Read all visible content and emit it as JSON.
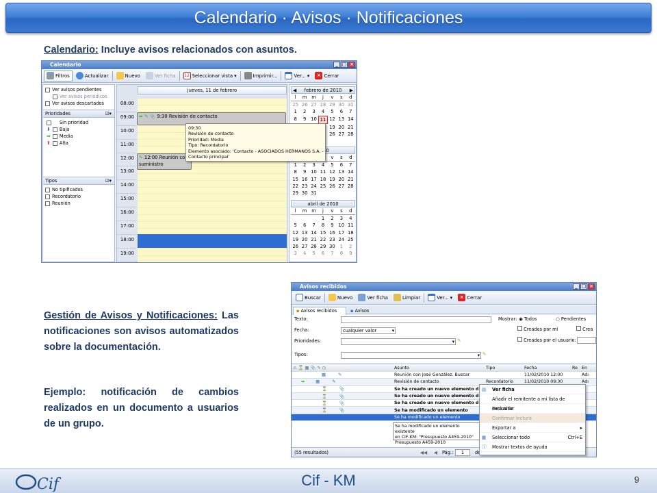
{
  "slide": {
    "title": "Calendario · Avisos · Notificaciones",
    "footer": "Cif - KM",
    "page": "9",
    "logo": "Cif"
  },
  "text1": {
    "label": "Calendario:",
    "body": " Incluye avisos relacionados con asuntos."
  },
  "text2": {
    "label": "Gestión de Avisos y Notificaciones:",
    "body": " Las notificaciones son avisos automatizados sobre la documentación.",
    "example": "Ejemplo: notificación de cambios realizados en un documento a usuarios de un grupo."
  },
  "cal": {
    "title": "Calendario",
    "toolbar": [
      "Filtros",
      "Actualizar",
      "Nuevo",
      "Ver ficha",
      "Seleccionar vista",
      "Imprimir...",
      "Ver...",
      "Cerrar"
    ],
    "filters": [
      "Ver avisos pendientes",
      "Ver avisos periódicos",
      "Ver avisos descartados"
    ],
    "prioridades": {
      "label": "Prioridades",
      "items": [
        "Sin prioridad",
        "Baja",
        "Media",
        "Alta"
      ]
    },
    "tipos": {
      "label": "Tipos",
      "items": [
        "No tipificados",
        "Recordatorio",
        "Reunión"
      ]
    },
    "day": "jueves, 11 de febrero",
    "hours": [
      "08:00",
      "09:00",
      "10:00",
      "11:00",
      "12:00",
      "13:00",
      "14:00",
      "15:00",
      "16:00",
      "17:00",
      "18:00",
      "19:00"
    ],
    "event1": "9:30 Revisión de contacto",
    "event2": "12:00 Reunión co",
    "event2b": "suministro",
    "tooltip": [
      "09:30",
      "Revisión de contacto",
      "Prioridad: Media",
      "Tipo: Recordatorio",
      "Elemento asociado: 'Contacto - ASOCIADOS HERMANOS S.A. -",
      "Contacto principal'"
    ],
    "weekdays": [
      "l",
      "m",
      "m",
      "j",
      "v",
      "s",
      "d"
    ],
    "months": [
      {
        "name": "febrero de 2010",
        "rows": [
          [
            "25",
            "26",
            "27",
            "28",
            "29",
            "30",
            "31"
          ],
          [
            "1",
            "2",
            "3",
            "4",
            "5",
            "6",
            "7"
          ],
          [
            "8",
            "9",
            "10",
            "11",
            "12",
            "13",
            "14"
          ],
          [
            "15",
            "16",
            "17",
            "18",
            "19",
            "20",
            "21"
          ],
          [
            "22",
            "23",
            "24",
            "25",
            "26",
            "27",
            "28"
          ]
        ]
      },
      {
        "name": "2010",
        "rows": [
          [
            "1",
            "2",
            "3",
            "4",
            "5",
            "6",
            "7"
          ],
          [
            "8",
            "9",
            "10",
            "11",
            "12",
            "13",
            "14"
          ],
          [
            "15",
            "16",
            "17",
            "18",
            "19",
            "20",
            "21"
          ],
          [
            "22",
            "23",
            "24",
            "25",
            "26",
            "27",
            "28"
          ],
          [
            "29",
            "30",
            "31",
            "",
            "",
            "",
            ""
          ]
        ]
      },
      {
        "name": "abril de 2010",
        "rows": [
          [
            "",
            "",
            "",
            "1",
            "2",
            "3",
            "4"
          ],
          [
            "5",
            "6",
            "7",
            "8",
            "9",
            "10",
            "11"
          ],
          [
            "12",
            "13",
            "14",
            "15",
            "16",
            "17",
            "18"
          ],
          [
            "19",
            "20",
            "21",
            "22",
            "23",
            "24",
            "25"
          ],
          [
            "26",
            "27",
            "28",
            "29",
            "30",
            "1",
            "2"
          ],
          [
            "3",
            "4",
            "5",
            "6",
            "7",
            "8",
            "9"
          ]
        ]
      }
    ]
  },
  "av": {
    "title": "Avisos recibidos",
    "toolbar": [
      "Buscar",
      "Nuevo",
      "Ver ficha",
      "Limpiar",
      "Ver...",
      "Cerrar"
    ],
    "tabs": [
      "Avisos recibidos",
      "Avisos enviados"
    ],
    "form": {
      "texto": "Texto:",
      "fecha": "Fecha:",
      "fecha_val": "cualquier valor",
      "prioridades": "Prioridades:",
      "tipos": "Tipos:",
      "mostrar": "Mostrar:",
      "todos": "Todos",
      "pendientes": "Pendientes",
      "creadas_mi": "Creadas por mí",
      "crea": "Crea",
      "creadas_usuario": "Creadas por el usuario:"
    },
    "cols": [
      "Asunto",
      "Tipo",
      "Fecha",
      "Re",
      "En"
    ],
    "rows": [
      {
        "asunto": "Reunión con José González. Buscar",
        "tipo": "",
        "fecha": "11/02/2010 12:00",
        "en": "Adı"
      },
      {
        "asunto": "Revisión de contacto",
        "tipo": "Recordatorio",
        "fecha": "11/02/2010 09:30",
        "en": "Adı"
      },
      {
        "asunto": "Se ha creado un nuevo elemento d",
        "tipo": "",
        "fecha": "",
        "en": ""
      },
      {
        "asunto": "Se ha creado un nuevo elemento d",
        "tipo": "",
        "fecha": "",
        "en": ""
      },
      {
        "asunto": "Se ha creado un nuevo elemento d",
        "tipo": "",
        "fecha": "",
        "en": ""
      },
      {
        "asunto": "Se ha modificado un elemento",
        "tipo": "",
        "fecha": "",
        "en": ""
      }
    ],
    "preview": [
      "Se ha modificado un elemento existente",
      "en CIF-KM: \"Presupuesto A459-2010\"",
      "Presupuesto A459-2010"
    ],
    "row_last": "Se ha modificado un elemento",
    "ctx": [
      "Ver ficha",
      "Añadir el remitente a mi lista de exclusión",
      "Descartar",
      "Confirmar lectura",
      "Exportar a",
      "Seleccionar todo",
      "Ctrl+E",
      "Mostrar textos de ayuda"
    ],
    "status": "(55 resultados)",
    "pager": {
      "label": "Pág.:",
      "page": "1",
      "of": "de 3"
    }
  },
  "colors": {
    "accent": "#3e7fd6",
    "text": "#1d3a66",
    "selected": "#2f6ed0"
  }
}
